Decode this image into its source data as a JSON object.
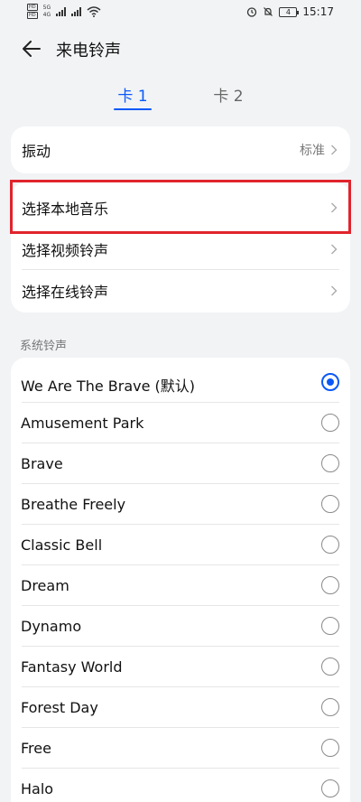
{
  "status_bar": {
    "sim1_tag": "HD",
    "sim2_tag": "HD",
    "net1": "5G",
    "net2": "4G",
    "battery_level": "4",
    "time": "15:17"
  },
  "header": {
    "title": "来电铃声",
    "back_icon": "arrow-left-icon"
  },
  "tabs": [
    {
      "label": "卡 1",
      "selected": true
    },
    {
      "label": "卡 2",
      "selected": false
    }
  ],
  "vibrate": {
    "label": "振动",
    "value": "标准"
  },
  "sources": [
    {
      "label": "选择本地音乐"
    },
    {
      "label": "选择视频铃声"
    },
    {
      "label": "选择在线铃声"
    }
  ],
  "section_title": "系统铃声",
  "ringtones": [
    {
      "label": "We Are The Brave (默认)",
      "selected": true
    },
    {
      "label": "Amusement Park",
      "selected": false
    },
    {
      "label": "Brave",
      "selected": false
    },
    {
      "label": "Breathe Freely",
      "selected": false
    },
    {
      "label": "Classic Bell",
      "selected": false
    },
    {
      "label": "Dream",
      "selected": false
    },
    {
      "label": "Dynamo",
      "selected": false
    },
    {
      "label": "Fantasy World",
      "selected": false
    },
    {
      "label": "Forest Day",
      "selected": false
    },
    {
      "label": "Free",
      "selected": false
    },
    {
      "label": "Halo",
      "selected": false
    }
  ],
  "colors": {
    "accent": "#0a59f7",
    "highlight": "#e0242c",
    "background": "#f1f3f5"
  }
}
